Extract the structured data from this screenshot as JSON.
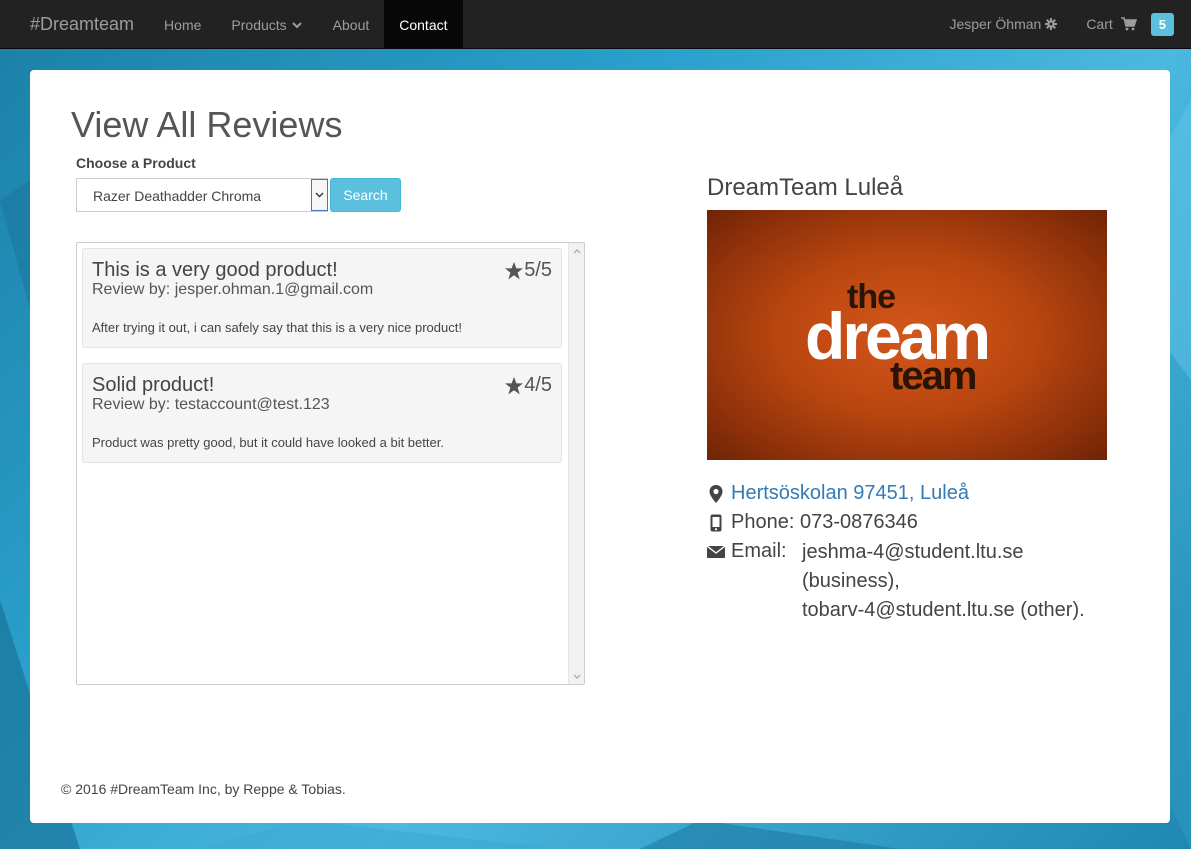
{
  "navbar": {
    "brand": "#Dreamteam",
    "items": [
      {
        "label": "Home"
      },
      {
        "label": "Products"
      },
      {
        "label": "About"
      },
      {
        "label": "Contact"
      }
    ],
    "user": "Jesper Öhman",
    "cart_label": "Cart",
    "cart_count": "5"
  },
  "page": {
    "title": "View All Reviews",
    "choose_label": "Choose a Product",
    "selected_product": "Razer Deathadder Chroma",
    "search_button": "Search"
  },
  "reviews": [
    {
      "title": "This is a very good product!",
      "by": "Review by: jesper.ohman.1@gmail.com",
      "rating": "5/5",
      "body": "After trying it out, i can safely say that this is a very nice product!"
    },
    {
      "title": "Solid product!",
      "by": "Review by: testaccount@test.123",
      "rating": "4/5",
      "body": "Product was pretty good, but it could have looked a bit better."
    }
  ],
  "office": {
    "title": "DreamTeam Luleå",
    "logo_the": "the",
    "logo_dream": "dream",
    "logo_team": "team",
    "address": "Hertsöskolan 97451, Luleå",
    "phone": "Phone: 073-0876346",
    "email_label": "Email:",
    "email_line1": "jeshma-4@student.ltu.se",
    "email_line2": "(business),",
    "email_line3": "tobarv-4@student.ltu.se (other)."
  },
  "footer": {
    "text": "© 2016 #DreamTeam Inc, by Reppe & Tobias."
  },
  "colors": {
    "accent": "#5bc0de",
    "link": "#337ab7",
    "navbar": "#222222"
  }
}
